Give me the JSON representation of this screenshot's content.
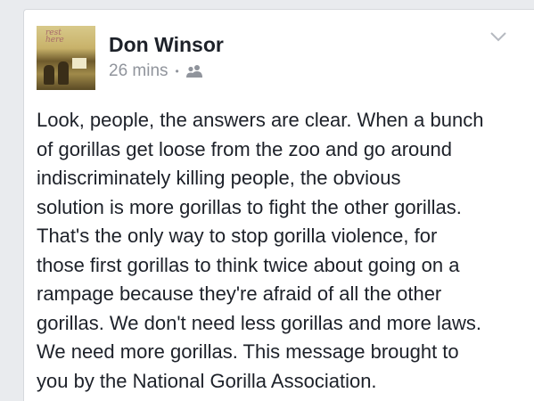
{
  "post": {
    "author": "Don Winsor",
    "timestamp": "26 mins",
    "separator": "•",
    "audience_icon": "friends-icon",
    "avatar_text": "rest here",
    "menu_icon": "chevron-down-icon",
    "lines": [
      "Look, people, the answers are clear. When a bunch",
      "of gorillas get loose from the zoo and go around",
      "indiscriminately killing people, the obvious",
      "solution is more gorillas to fight the other gorillas.",
      "That's the only way to stop gorilla violence, for",
      "those first gorillas to think twice about going on a",
      "rampage because they're afraid of all the other",
      "gorillas. We don't need less gorillas and more laws.",
      "We need more gorillas. This message brought to",
      "you by the National Gorilla Association."
    ]
  },
  "colors": {
    "background": "#e9ebee",
    "card": "#ffffff",
    "name": "#1d2129",
    "meta": "#90949c"
  }
}
